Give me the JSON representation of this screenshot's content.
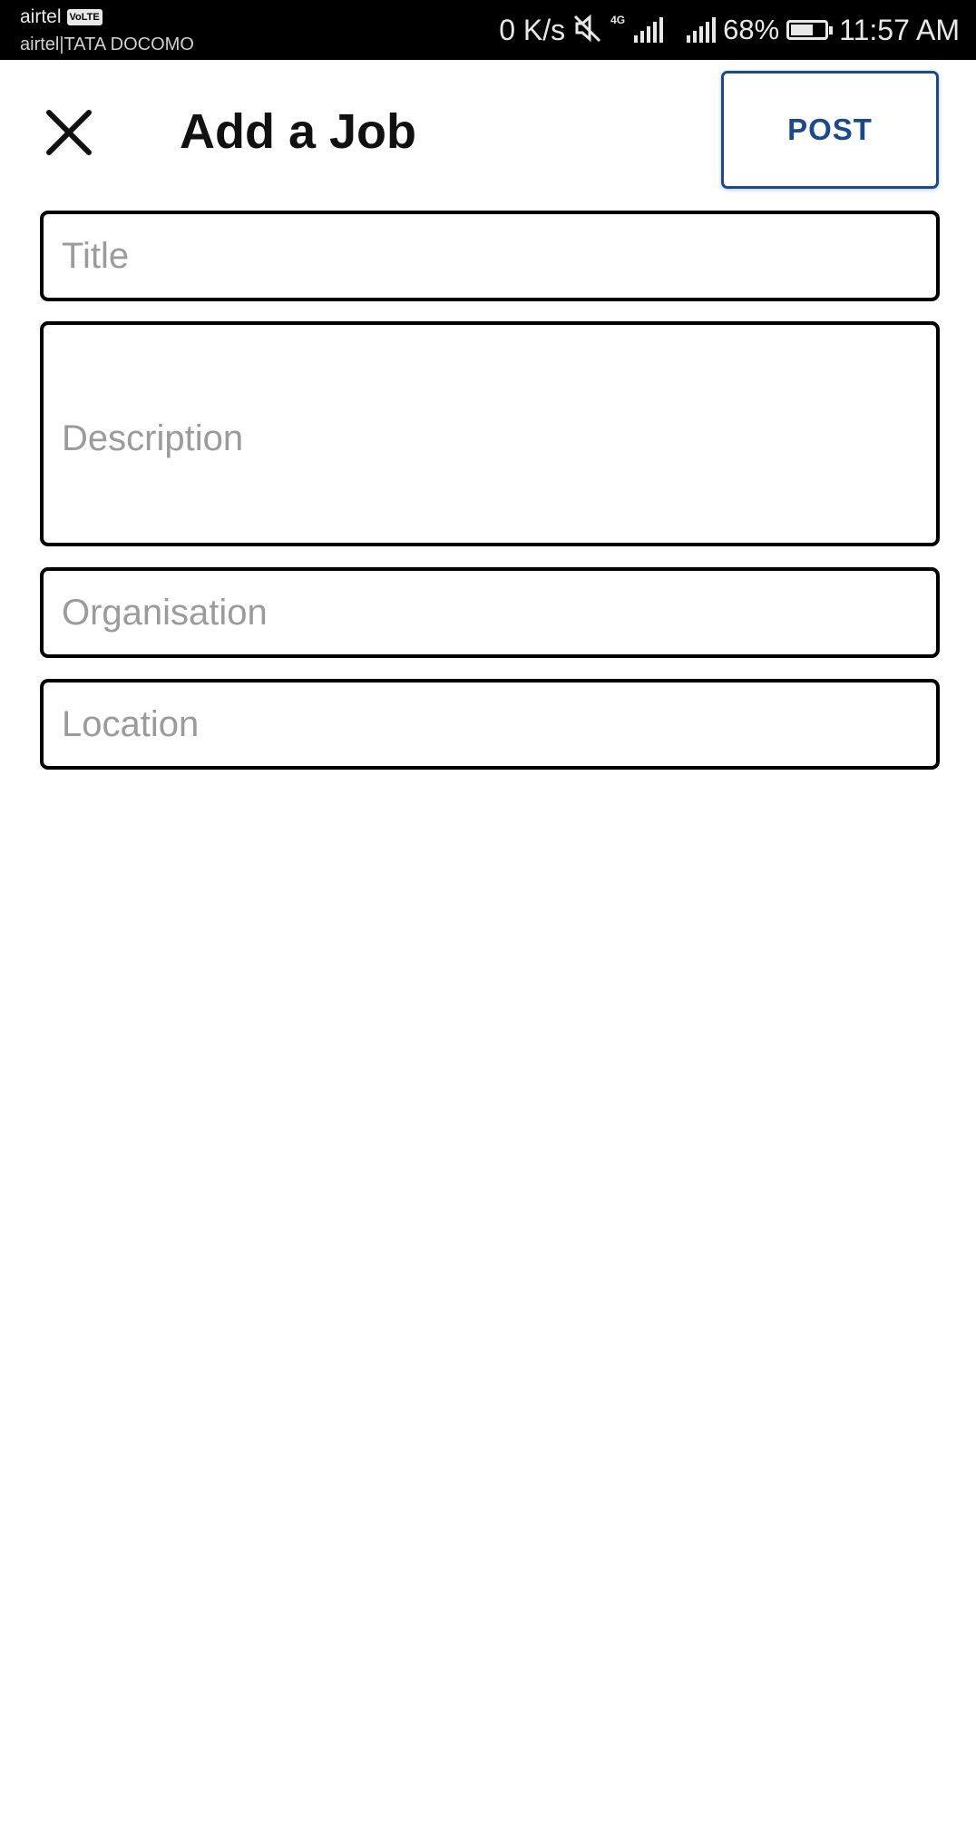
{
  "status_bar": {
    "carrier_primary": "airtel",
    "volte_badge": "VoLTE",
    "carrier_secondary": "airtel|TATA DOCOMO",
    "net_speed": "0 K/s",
    "network_type": "4G",
    "battery_percent": "68%",
    "battery_level": 0.68,
    "time": "11:57 AM",
    "icons": [
      "mute-icon",
      "signal-icon",
      "signal-icon",
      "battery-icon"
    ]
  },
  "header": {
    "title": "Add a Job",
    "close_icon": "close-icon",
    "post_label": "POST"
  },
  "form": {
    "title_placeholder": "Title",
    "description_placeholder": "Description",
    "organisation_placeholder": "Organisation",
    "location_placeholder": "Location"
  },
  "colors": {
    "accent": "#1a4a8c",
    "placeholder": "#9b9b9b",
    "field_border": "#000000"
  }
}
